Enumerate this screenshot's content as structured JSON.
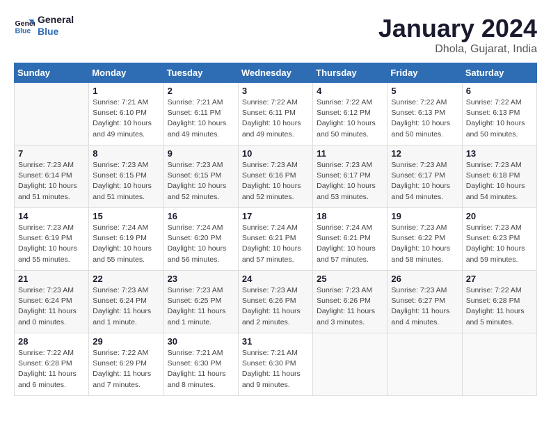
{
  "logo": {
    "text_general": "General",
    "text_blue": "Blue"
  },
  "title": "January 2024",
  "subtitle": "Dhola, Gujarat, India",
  "weekdays": [
    "Sunday",
    "Monday",
    "Tuesday",
    "Wednesday",
    "Thursday",
    "Friday",
    "Saturday"
  ],
  "weeks": [
    [
      {
        "day": "",
        "sunrise": "",
        "sunset": "",
        "daylight": ""
      },
      {
        "day": "1",
        "sunrise": "Sunrise: 7:21 AM",
        "sunset": "Sunset: 6:10 PM",
        "daylight": "Daylight: 10 hours and 49 minutes."
      },
      {
        "day": "2",
        "sunrise": "Sunrise: 7:21 AM",
        "sunset": "Sunset: 6:11 PM",
        "daylight": "Daylight: 10 hours and 49 minutes."
      },
      {
        "day": "3",
        "sunrise": "Sunrise: 7:22 AM",
        "sunset": "Sunset: 6:11 PM",
        "daylight": "Daylight: 10 hours and 49 minutes."
      },
      {
        "day": "4",
        "sunrise": "Sunrise: 7:22 AM",
        "sunset": "Sunset: 6:12 PM",
        "daylight": "Daylight: 10 hours and 50 minutes."
      },
      {
        "day": "5",
        "sunrise": "Sunrise: 7:22 AM",
        "sunset": "Sunset: 6:13 PM",
        "daylight": "Daylight: 10 hours and 50 minutes."
      },
      {
        "day": "6",
        "sunrise": "Sunrise: 7:22 AM",
        "sunset": "Sunset: 6:13 PM",
        "daylight": "Daylight: 10 hours and 50 minutes."
      }
    ],
    [
      {
        "day": "7",
        "sunrise": "Sunrise: 7:23 AM",
        "sunset": "Sunset: 6:14 PM",
        "daylight": "Daylight: 10 hours and 51 minutes."
      },
      {
        "day": "8",
        "sunrise": "Sunrise: 7:23 AM",
        "sunset": "Sunset: 6:15 PM",
        "daylight": "Daylight: 10 hours and 51 minutes."
      },
      {
        "day": "9",
        "sunrise": "Sunrise: 7:23 AM",
        "sunset": "Sunset: 6:15 PM",
        "daylight": "Daylight: 10 hours and 52 minutes."
      },
      {
        "day": "10",
        "sunrise": "Sunrise: 7:23 AM",
        "sunset": "Sunset: 6:16 PM",
        "daylight": "Daylight: 10 hours and 52 minutes."
      },
      {
        "day": "11",
        "sunrise": "Sunrise: 7:23 AM",
        "sunset": "Sunset: 6:17 PM",
        "daylight": "Daylight: 10 hours and 53 minutes."
      },
      {
        "day": "12",
        "sunrise": "Sunrise: 7:23 AM",
        "sunset": "Sunset: 6:17 PM",
        "daylight": "Daylight: 10 hours and 54 minutes."
      },
      {
        "day": "13",
        "sunrise": "Sunrise: 7:23 AM",
        "sunset": "Sunset: 6:18 PM",
        "daylight": "Daylight: 10 hours and 54 minutes."
      }
    ],
    [
      {
        "day": "14",
        "sunrise": "Sunrise: 7:23 AM",
        "sunset": "Sunset: 6:19 PM",
        "daylight": "Daylight: 10 hours and 55 minutes."
      },
      {
        "day": "15",
        "sunrise": "Sunrise: 7:24 AM",
        "sunset": "Sunset: 6:19 PM",
        "daylight": "Daylight: 10 hours and 55 minutes."
      },
      {
        "day": "16",
        "sunrise": "Sunrise: 7:24 AM",
        "sunset": "Sunset: 6:20 PM",
        "daylight": "Daylight: 10 hours and 56 minutes."
      },
      {
        "day": "17",
        "sunrise": "Sunrise: 7:24 AM",
        "sunset": "Sunset: 6:21 PM",
        "daylight": "Daylight: 10 hours and 57 minutes."
      },
      {
        "day": "18",
        "sunrise": "Sunrise: 7:24 AM",
        "sunset": "Sunset: 6:21 PM",
        "daylight": "Daylight: 10 hours and 57 minutes."
      },
      {
        "day": "19",
        "sunrise": "Sunrise: 7:23 AM",
        "sunset": "Sunset: 6:22 PM",
        "daylight": "Daylight: 10 hours and 58 minutes."
      },
      {
        "day": "20",
        "sunrise": "Sunrise: 7:23 AM",
        "sunset": "Sunset: 6:23 PM",
        "daylight": "Daylight: 10 hours and 59 minutes."
      }
    ],
    [
      {
        "day": "21",
        "sunrise": "Sunrise: 7:23 AM",
        "sunset": "Sunset: 6:24 PM",
        "daylight": "Daylight: 11 hours and 0 minutes."
      },
      {
        "day": "22",
        "sunrise": "Sunrise: 7:23 AM",
        "sunset": "Sunset: 6:24 PM",
        "daylight": "Daylight: 11 hours and 1 minute."
      },
      {
        "day": "23",
        "sunrise": "Sunrise: 7:23 AM",
        "sunset": "Sunset: 6:25 PM",
        "daylight": "Daylight: 11 hours and 1 minute."
      },
      {
        "day": "24",
        "sunrise": "Sunrise: 7:23 AM",
        "sunset": "Sunset: 6:26 PM",
        "daylight": "Daylight: 11 hours and 2 minutes."
      },
      {
        "day": "25",
        "sunrise": "Sunrise: 7:23 AM",
        "sunset": "Sunset: 6:26 PM",
        "daylight": "Daylight: 11 hours and 3 minutes."
      },
      {
        "day": "26",
        "sunrise": "Sunrise: 7:23 AM",
        "sunset": "Sunset: 6:27 PM",
        "daylight": "Daylight: 11 hours and 4 minutes."
      },
      {
        "day": "27",
        "sunrise": "Sunrise: 7:22 AM",
        "sunset": "Sunset: 6:28 PM",
        "daylight": "Daylight: 11 hours and 5 minutes."
      }
    ],
    [
      {
        "day": "28",
        "sunrise": "Sunrise: 7:22 AM",
        "sunset": "Sunset: 6:28 PM",
        "daylight": "Daylight: 11 hours and 6 minutes."
      },
      {
        "day": "29",
        "sunrise": "Sunrise: 7:22 AM",
        "sunset": "Sunset: 6:29 PM",
        "daylight": "Daylight: 11 hours and 7 minutes."
      },
      {
        "day": "30",
        "sunrise": "Sunrise: 7:21 AM",
        "sunset": "Sunset: 6:30 PM",
        "daylight": "Daylight: 11 hours and 8 minutes."
      },
      {
        "day": "31",
        "sunrise": "Sunrise: 7:21 AM",
        "sunset": "Sunset: 6:30 PM",
        "daylight": "Daylight: 11 hours and 9 minutes."
      },
      {
        "day": "",
        "sunrise": "",
        "sunset": "",
        "daylight": ""
      },
      {
        "day": "",
        "sunrise": "",
        "sunset": "",
        "daylight": ""
      },
      {
        "day": "",
        "sunrise": "",
        "sunset": "",
        "daylight": ""
      }
    ]
  ]
}
